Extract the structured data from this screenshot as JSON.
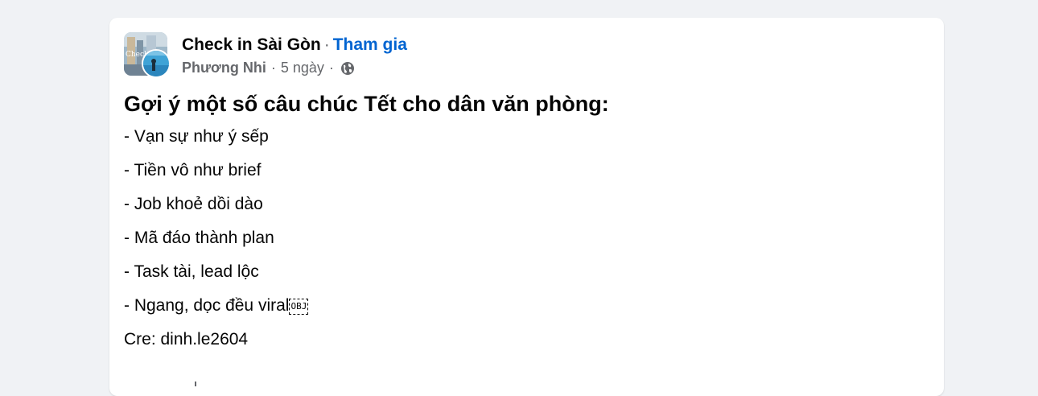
{
  "post": {
    "group_name": "Check in Sài Gòn",
    "separator": "·",
    "join_label": "Tham gia",
    "author": "Phương Nhi",
    "time": "5 ngày",
    "audience_icon": "globe-icon",
    "group_avatar_text": "Check in",
    "title": "Gợi ý một số câu chúc Tết cho dân văn phòng:",
    "items": [
      "- Vạn sự như ý sếp",
      "- Tiền vô như brief",
      "- Job khoẻ dồi dào",
      "- Mã đáo thành plan",
      "- Task tài, lead lộc",
      "- Ngang, dọc đều viral"
    ],
    "object_placeholder": "OBJ",
    "credit": "Cre: dinh.le2604"
  },
  "colors": {
    "page_bg": "#f0f2f5",
    "card_bg": "#ffffff",
    "link_blue": "#0064d1",
    "secondary_text": "#65676b",
    "primary_text": "#050505"
  }
}
